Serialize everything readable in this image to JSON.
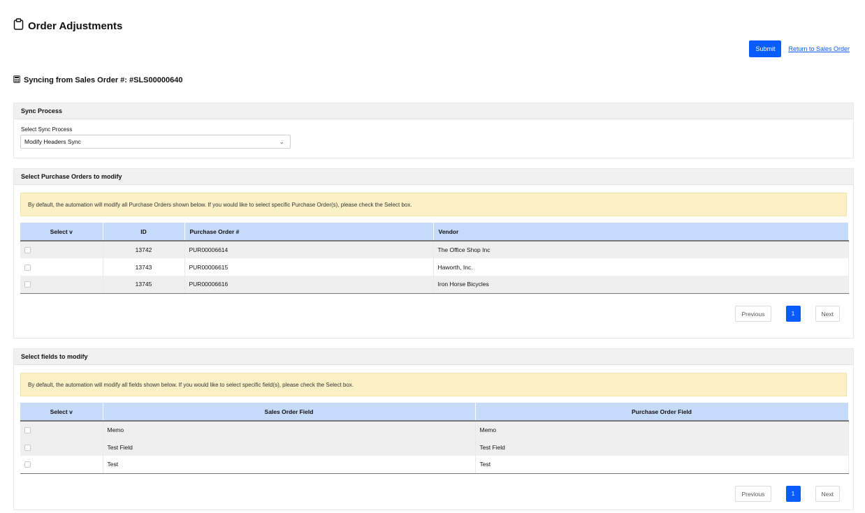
{
  "header": {
    "title": "Order Adjustments",
    "icon": "clipboard-icon"
  },
  "actions": {
    "submit_label": "Submit",
    "return_link": "Return to Sales Order",
    "accent": "#0b5cff"
  },
  "sync": {
    "title": "Syncing from Sales Order #: #SLS00000640",
    "icon": "calculator-icon"
  },
  "sync_process": {
    "heading": "Sync Process",
    "select_label": "Select Sync Process",
    "selected_value": "Modify Headers Sync"
  },
  "purchase_orders": {
    "heading": "Select Purchase Orders to modify",
    "notice": "By default, the automation will modify all Purchase Orders shown below. If you would like to select specific Purchase Order(s), please check the Select box.",
    "columns": [
      "Select v",
      "ID",
      "Purchase Order #",
      "Vendor"
    ],
    "rows": [
      {
        "id": "13742",
        "po": "PUR00006614",
        "vendor": "The Office Shop Inc"
      },
      {
        "id": "13743",
        "po": "PUR00006615",
        "vendor": "Haworth, Inc."
      },
      {
        "id": "13745",
        "po": "PUR00006616",
        "vendor": "Iron Horse Bicycles"
      }
    ],
    "pager": {
      "previous": "Previous",
      "page": "1",
      "next": "Next"
    }
  },
  "fields": {
    "heading": "Select fields to modify",
    "notice": "By default, the automation will modify all fields shown below. If you would like to select specific field(s), please check the Select box.",
    "columns": [
      "Select v",
      "Sales Order Field",
      "Purchase Order Field"
    ],
    "rows": [
      {
        "sales": "Memo",
        "purchase": "Memo"
      },
      {
        "sales": "Test Field",
        "purchase": "Test Field"
      },
      {
        "sales": "Test",
        "purchase": "Test"
      }
    ],
    "pager": {
      "previous": "Previous",
      "page": "1",
      "next": "Next"
    }
  }
}
